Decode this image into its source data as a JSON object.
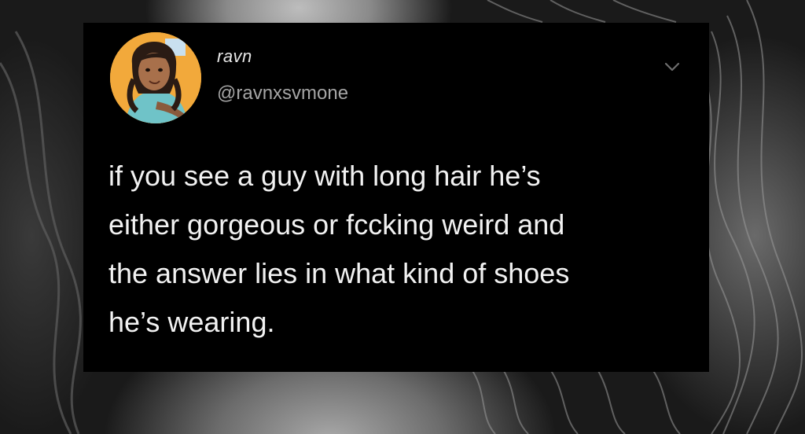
{
  "tweet": {
    "display_name": "ravn",
    "handle": "@ravnxsvmone",
    "text": "if you see a guy with long hair he’s\neither gorgeous or fccking weird and\nthe answer lies in what kind of shoes\nhe’s wearing.",
    "menu_icon": "chevron-down-icon",
    "avatar_icon": "cartoon-avatar"
  },
  "colors": {
    "card_background": "#000000",
    "text_primary": "#f2f2f2",
    "text_secondary": "#a5a5a5",
    "avatar_background": "#f2a93b"
  }
}
